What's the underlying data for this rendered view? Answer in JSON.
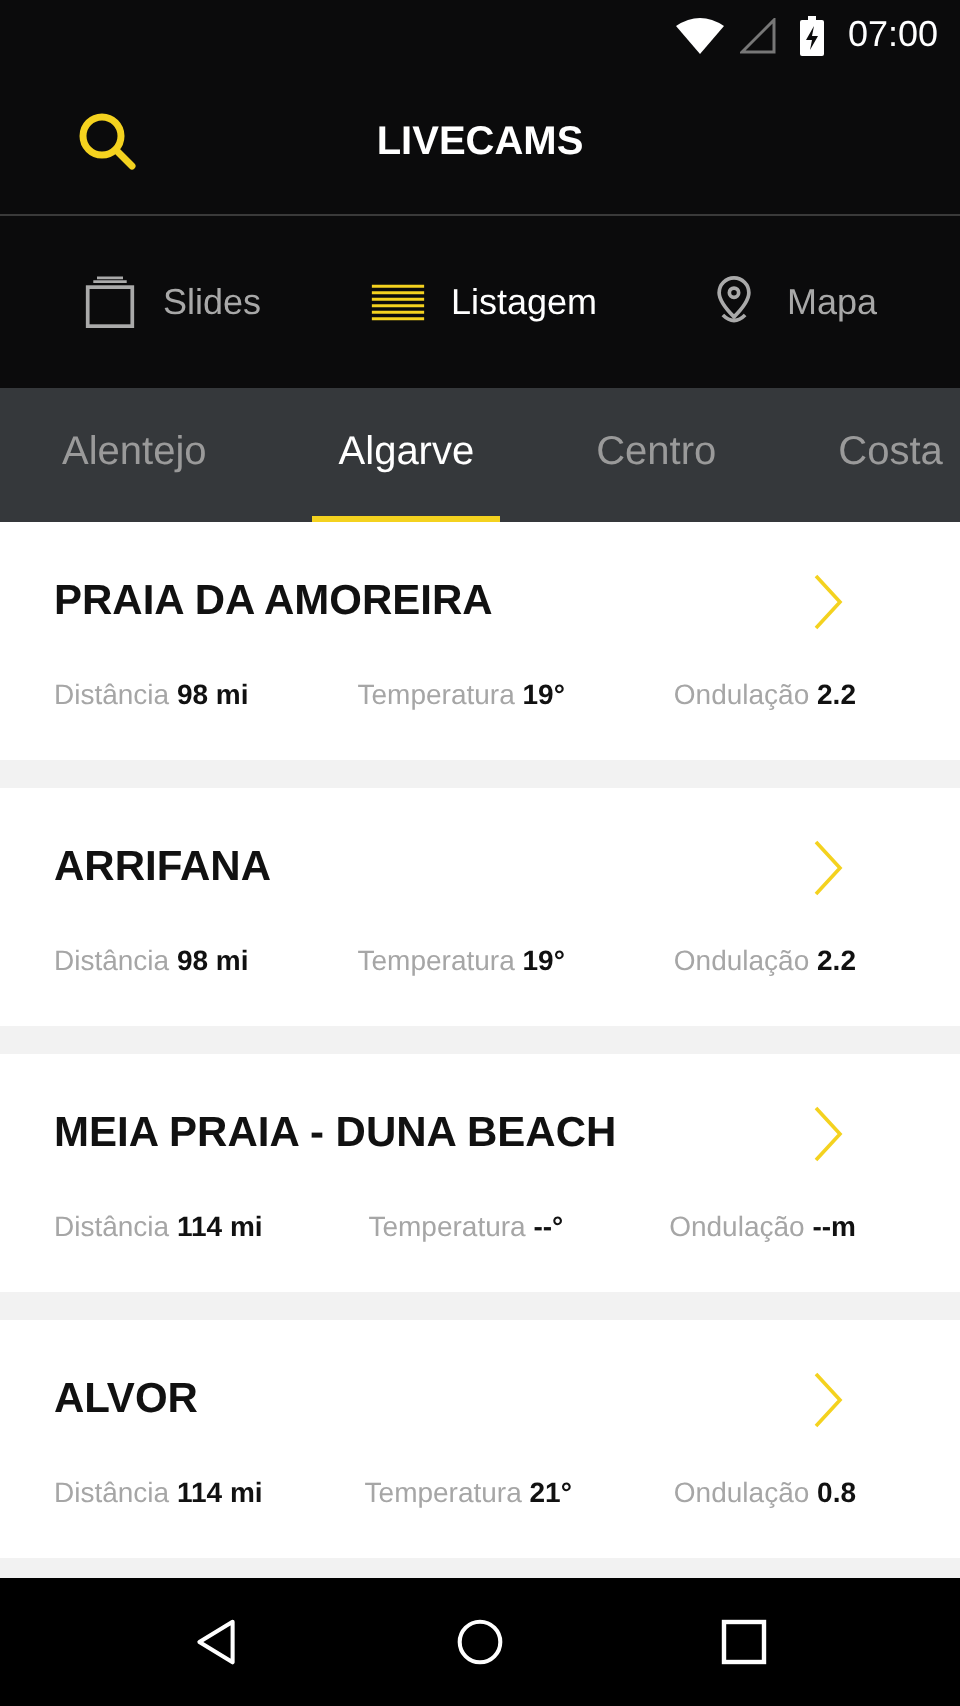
{
  "status_bar": {
    "time": "07:00"
  },
  "app_bar": {
    "title": "LIVECAMS"
  },
  "view_modes": [
    {
      "kind": "slides",
      "label": "Slides",
      "selected": false
    },
    {
      "kind": "list",
      "label": "Listagem",
      "selected": true
    },
    {
      "kind": "map",
      "label": "Mapa",
      "selected": false
    }
  ],
  "region_tabs": [
    {
      "label": "Alentejo",
      "selected": false
    },
    {
      "label": "Algarve",
      "selected": true
    },
    {
      "label": "Centro",
      "selected": false
    },
    {
      "label": "Costa",
      "selected": false
    }
  ],
  "cams": [
    {
      "name": "PRAIA DA AMOREIRA",
      "stats": [
        {
          "label": "Distância",
          "value": "98 mi"
        },
        {
          "label": "Temperatura",
          "value": "19°"
        },
        {
          "label": "Ondulação",
          "value": "2.2"
        }
      ]
    },
    {
      "name": "ARRIFANA",
      "stats": [
        {
          "label": "Distância",
          "value": "98 mi"
        },
        {
          "label": "Temperatura",
          "value": "19°"
        },
        {
          "label": "Ondulação",
          "value": "2.2"
        }
      ]
    },
    {
      "name": "MEIA PRAIA - DUNA BEACH",
      "stats": [
        {
          "label": "Distância",
          "value": "114 mi"
        },
        {
          "label": "Temperatura",
          "value": "--°"
        },
        {
          "label": "Ondulação",
          "value": "--m"
        }
      ]
    },
    {
      "name": "ALVOR",
      "stats": [
        {
          "label": "Distância",
          "value": "114 mi"
        },
        {
          "label": "Temperatura",
          "value": "21°"
        },
        {
          "label": "Ondulação",
          "value": "0.8"
        }
      ]
    }
  ]
}
